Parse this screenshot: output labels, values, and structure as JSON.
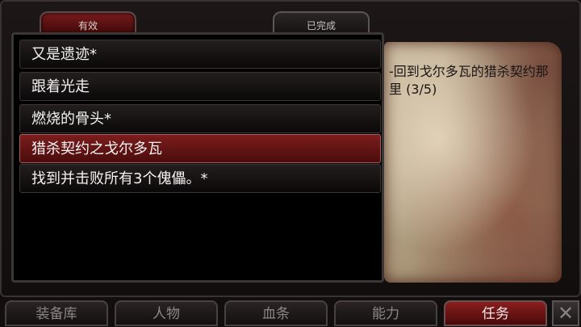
{
  "tabs": [
    {
      "label": "有效",
      "active": true
    },
    {
      "label": "已完成",
      "active": false
    }
  ],
  "quests": [
    {
      "title": "又是遗迹*",
      "selected": false
    },
    {
      "title": "跟着光走",
      "selected": false
    },
    {
      "title": "燃烧的骨头*",
      "selected": false
    },
    {
      "title": "猎杀契约之戈尔多瓦",
      "selected": true
    },
    {
      "title": "找到并击败所有3个傀儡。*",
      "selected": false
    }
  ],
  "detail": {
    "text": "-回到戈尔多瓦的猎杀契约那里 (3/5)"
  },
  "nav": {
    "items": [
      {
        "label": "装备库",
        "active": false
      },
      {
        "label": "人物",
        "active": false
      },
      {
        "label": "血条",
        "active": false
      },
      {
        "label": "能力",
        "active": false
      },
      {
        "label": "任务",
        "active": true
      }
    ],
    "close_icon": "close-icon"
  },
  "colors": {
    "accent_red": "#7a1b1b",
    "panel_bg": "#000000",
    "parchment": "#cdbfa3"
  }
}
